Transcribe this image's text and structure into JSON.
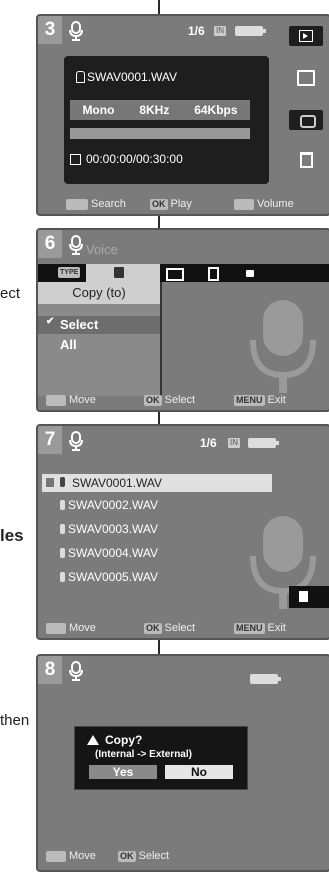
{
  "side": {
    "text1": "ect",
    "text2": "les",
    "text3": "then"
  },
  "panel3": {
    "step": "3",
    "counter": "1/6",
    "mem_label": "IN",
    "filename": "SWAV0001.WAV",
    "channel": "Mono",
    "rate": "8KHz",
    "bitrate": "64Kbps",
    "time": "00:00:00/00:30:00",
    "progress_fraction": 0.0,
    "hints": {
      "search": "Search",
      "ok_key": "OK",
      "play": "Play",
      "volume": "Volume"
    }
  },
  "panel6": {
    "step": "6",
    "title": "Voice",
    "type_key": "TYPE",
    "menu_header": "Copy (to)",
    "options": [
      "Select",
      "All"
    ],
    "hints": {
      "move": "Move",
      "ok_key": "OK",
      "select": "Select",
      "menu_key": "MENU",
      "exit": "Exit"
    }
  },
  "panel7": {
    "step": "7",
    "counter": "1/6",
    "mem_label": "IN",
    "files": [
      "SWAV0001.WAV",
      "SWAV0002.WAV",
      "SWAV0003.WAV",
      "SWAV0004.WAV",
      "SWAV0005.WAV"
    ],
    "hints": {
      "move": "Move",
      "ok_key": "OK",
      "select": "Select",
      "menu_key": "MENU",
      "exit": "Exit"
    }
  },
  "panel8": {
    "step": "8",
    "dialog_title": "Copy?",
    "dialog_sub": "(Internal -> External)",
    "yes": "Yes",
    "no": "No",
    "hints": {
      "move": "Move",
      "ok_key": "OK",
      "select": "Select"
    }
  },
  "colors": {
    "panel_bg": "#7b7b7b",
    "dark": "#1e1e1e",
    "highlight": "#d9d9d9"
  }
}
